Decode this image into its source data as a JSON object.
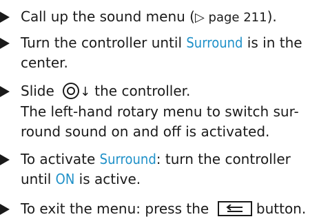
{
  "steps": [
    {
      "line1_a": "Call up the sound menu (",
      "page_ref": "▷ page 211",
      "line1_b": ")."
    },
    {
      "line1_a": "Turn the controller until ",
      "highlight": "Surround",
      "line1_b": " is in the",
      "line2": "center."
    },
    {
      "line1_a": "Slide ",
      "arrow": "↓",
      "line1_b": "the controller.",
      "line2": "The left-hand rotary menu to switch sur-",
      "line3": "round sound on and off is activated."
    },
    {
      "line1_a": "To activate ",
      "highlight": "Surround",
      "line1_b": ": turn the controller",
      "line2_a": "until ",
      "highlight2": "ON",
      "line2_b": " is active."
    },
    {
      "line1_a": "To exit the menu: press the ",
      "line1_b": " button."
    }
  ],
  "colors": {
    "highlight": "#1e90c8",
    "text": "#1a1a1a"
  },
  "icons": {
    "bullet": "triangle-right-icon",
    "controller": "controller-knob-icon",
    "back": "back-arrow-icon"
  }
}
